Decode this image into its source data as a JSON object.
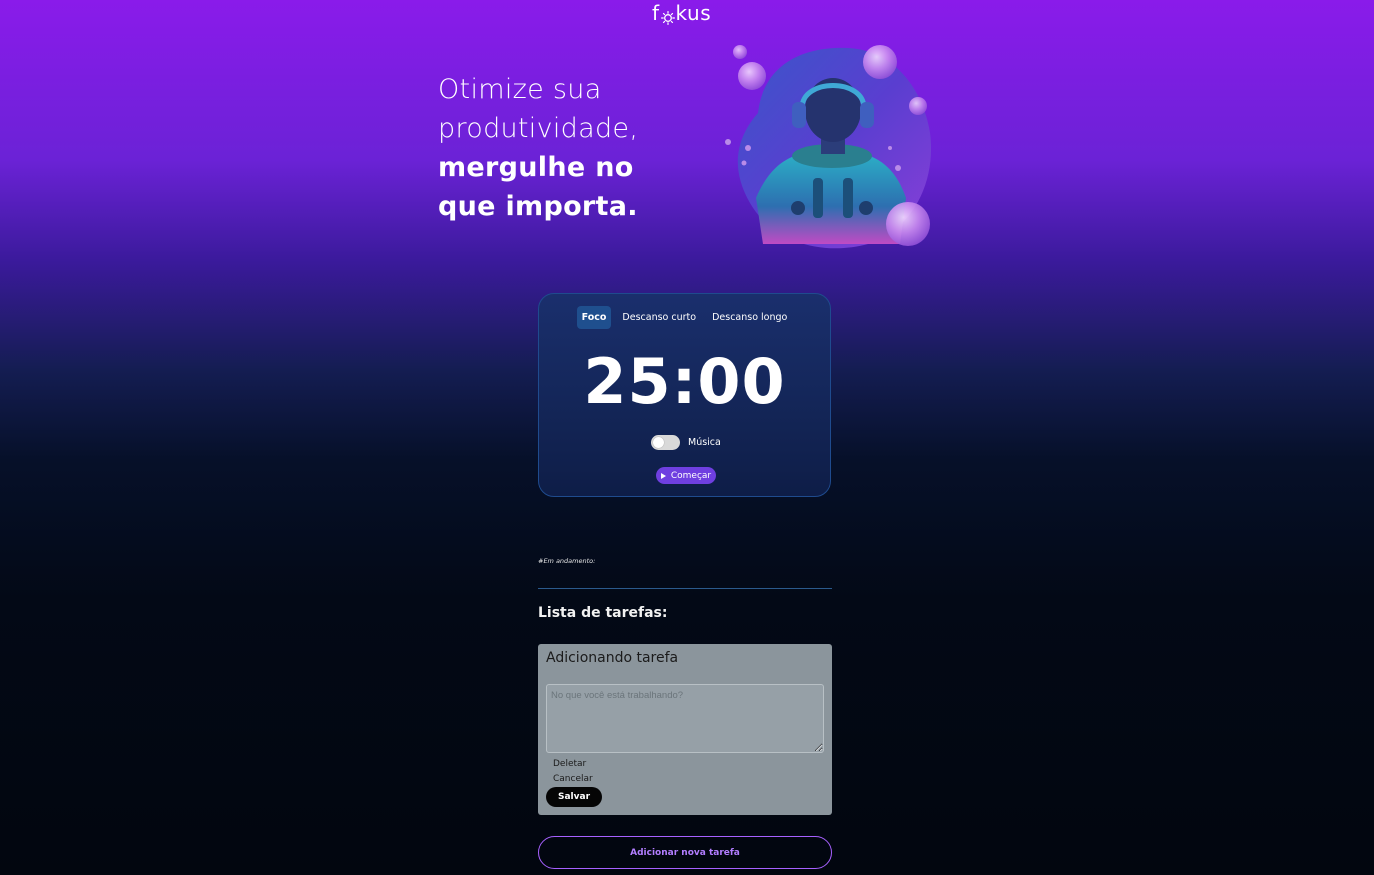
{
  "header": {
    "logo_prefix": "f",
    "logo_suffix": "kus",
    "logo_icon": "sun-icon"
  },
  "hero": {
    "line1": "Otimize sua",
    "line2": "produtividade,",
    "line3": "mergulhe no",
    "line4": "que importa."
  },
  "timer": {
    "tabs": [
      {
        "label": "Foco",
        "active": true
      },
      {
        "label": "Descanso curto",
        "active": false
      },
      {
        "label": "Descanso longo",
        "active": false
      }
    ],
    "time": "25:00",
    "music_label": "Música",
    "music_enabled": false,
    "start_label": "Começar",
    "start_icon": "play-icon"
  },
  "tasks": {
    "in_progress_label": "#Em andamento:",
    "list_title": "Lista de tarefas:",
    "form": {
      "title": "Adicionando tarefa",
      "placeholder": "No que você está trabalhando?",
      "value": "",
      "delete_label": "Deletar",
      "cancel_label": "Cancelar",
      "save_label": "Salvar"
    },
    "add_button_label": "Adicionar nova tarefa"
  },
  "colors": {
    "accent": "#8a1bea",
    "card_border": "#1f4b8e",
    "add_button": "#a760ff"
  }
}
